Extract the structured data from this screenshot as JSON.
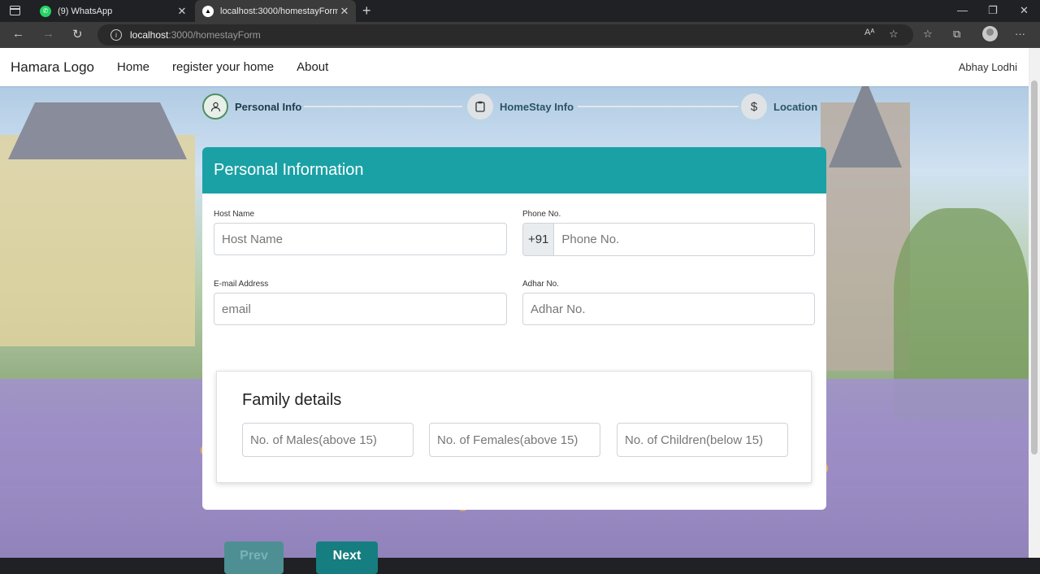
{
  "browser": {
    "tabs": [
      {
        "title": "(9) WhatsApp",
        "active": false
      },
      {
        "title": "localhost:3000/homestayForm",
        "active": true
      }
    ],
    "address": {
      "host": "localhost",
      "path": ":3000/homestayForm"
    }
  },
  "navbar": {
    "brand": "Hamara Logo",
    "links": [
      "Home",
      "register your home",
      "About"
    ],
    "user": "Abhay Lodhi"
  },
  "stepper": {
    "steps": [
      {
        "label": "Personal Info",
        "icon": "user-icon",
        "active": true
      },
      {
        "label": "HomeStay Info",
        "icon": "clipboard-icon",
        "active": false
      },
      {
        "label": "Location",
        "icon": "dollar-icon",
        "active": false
      }
    ]
  },
  "form": {
    "title": "Personal Information",
    "host_name": {
      "label": "Host Name",
      "placeholder": "Host Name"
    },
    "phone": {
      "label": "Phone No.",
      "prefix": "+91",
      "placeholder": "Phone No."
    },
    "email": {
      "label": "E-mail Address",
      "placeholder": "email"
    },
    "adhar": {
      "label": "Adhar No.",
      "placeholder": "Adhar No."
    },
    "family": {
      "title": "Family details",
      "males_placeholder": "No. of Males(above 15)",
      "females_placeholder": "No. of Females(above 15)",
      "children_placeholder": "No. of Children(below 15)"
    }
  },
  "buttons": {
    "prev": "Prev",
    "next": "Next"
  },
  "colors": {
    "accent": "#1aa1a6",
    "next_button": "#167d80"
  }
}
